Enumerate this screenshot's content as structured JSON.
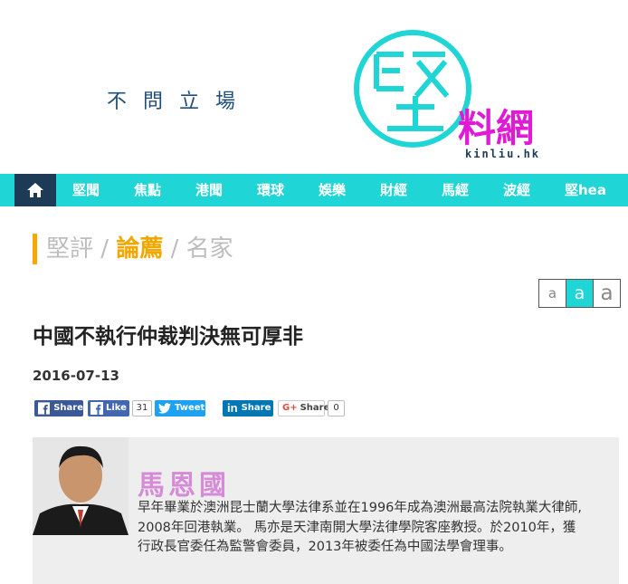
{
  "header": {
    "slogan": "不問立場",
    "logo_char": "堅",
    "logo_sub": "料網",
    "logo_domain": "kinliu.hk",
    "colors": {
      "teal": "#1fd5d5",
      "magenta": "#e01bd6"
    }
  },
  "nav": {
    "home_icon": "home-icon",
    "items": [
      {
        "label": "堅聞"
      },
      {
        "label": "焦點"
      },
      {
        "label": "港聞"
      },
      {
        "label": "環球"
      },
      {
        "label": "娛樂"
      },
      {
        "label": "財經"
      },
      {
        "label": "馬經"
      },
      {
        "label": "波經"
      },
      {
        "label": "堅hea"
      }
    ]
  },
  "breadcrumb": {
    "items": [
      {
        "label": "堅評"
      },
      {
        "label": "論薦"
      },
      {
        "label": "名家"
      }
    ],
    "separator": "/"
  },
  "font_size": {
    "options": [
      "a",
      "a",
      "a"
    ],
    "selected": 1
  },
  "article": {
    "title": "中國不執行仲裁判決無可厚非",
    "date": "2016-07-13"
  },
  "social": {
    "fb_share": "Share",
    "fb_like": "Like",
    "like_count": "31",
    "tweet": "Tweet",
    "linkedin_share": "Share",
    "gplus_share": "Share",
    "gplus_count": "0"
  },
  "author": {
    "name": "馬恩國",
    "bio": "早年畢業於澳洲昆士蘭大學法律系並在1996年成為澳洲最高法院執業大律師, 2008年回港執業。 馬亦是天津南開大學法律學院客座教授。於2010年，獲行政長官委任為監警會委員，2013年被委任為中國法學會理事。"
  }
}
